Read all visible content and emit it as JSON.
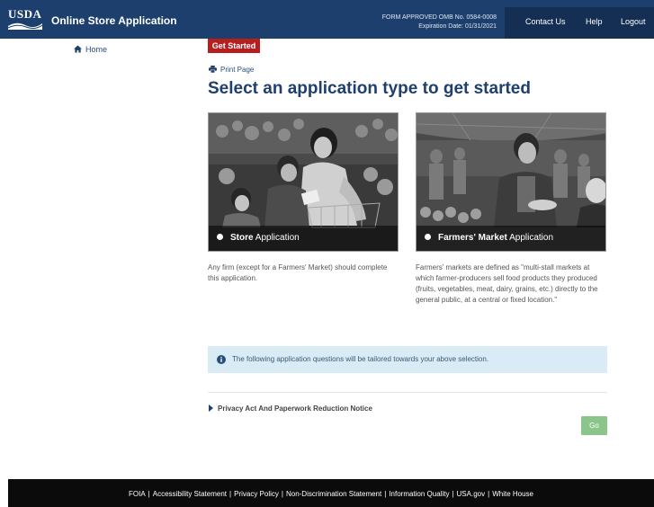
{
  "header": {
    "logo_text": "USDA",
    "app_title": "Online Store Application",
    "form_line1": "FORM APPROVED OMB No. 0584-0008",
    "form_line2": "Expiration Date: 01/31/2021",
    "nav": [
      "Contact Us",
      "Help",
      "Logout"
    ],
    "color": "#1c3f6e"
  },
  "sidebar": {
    "home_label": "Home"
  },
  "main": {
    "tab_label": "Get Started",
    "print_label": "Print Page",
    "title": "Select an application type to get started",
    "store": {
      "label_bold": "Store",
      "label_rest": " Application",
      "description": "Any firm (except for a Farmers' Market) should complete this application."
    },
    "market": {
      "label_bold": "Farmers' Market",
      "label_rest": " Application",
      "description": "Farmers' markets are defined as \"multi-stall markets at which farmer-producers sell food products they produced (fruits, vegetables, meat, dairy, grains, etc.) directly to the general public, at a central or fixed location.\""
    },
    "info_text": "The following application questions will be tailored towards your above selection.",
    "privacy_label": "Privacy Act And Paperwork Reduction Notice",
    "go_label": "Go"
  },
  "footer": {
    "links": [
      "FOIA",
      "Accessibility Statement",
      "Privacy Policy",
      "Non-Discrimination Statement",
      "Information Quality",
      "USA.gov",
      "White House"
    ]
  },
  "colors": {
    "tab_red": "#b51f1f",
    "go_green": "#8cc58c",
    "info_bg": "#d9ebf5"
  }
}
